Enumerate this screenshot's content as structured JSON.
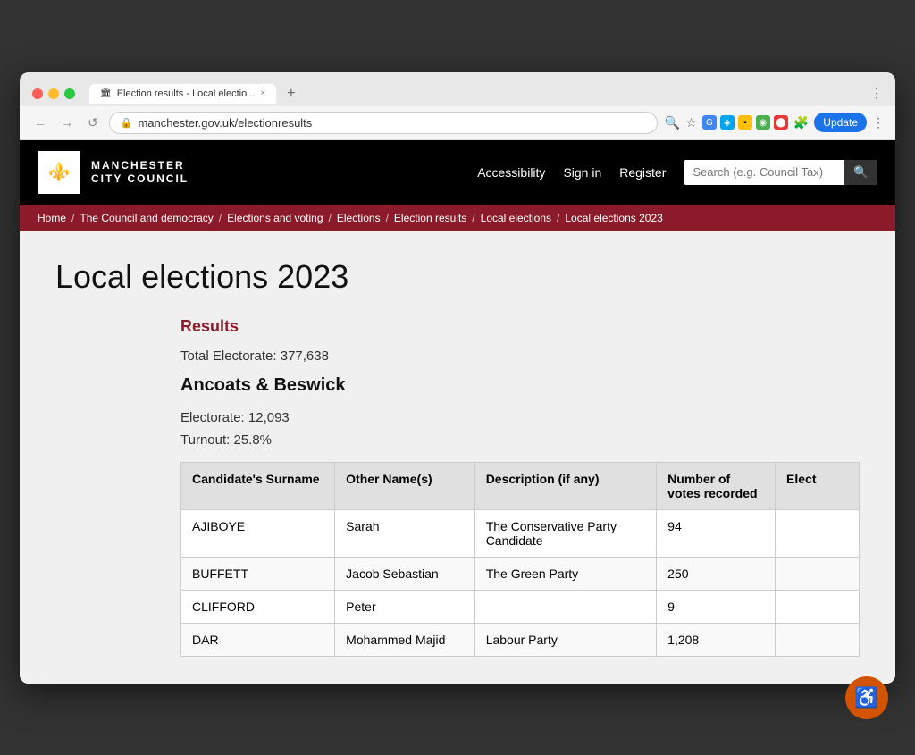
{
  "browser": {
    "tab_title": "Election results - Local electio...",
    "tab_close": "×",
    "url": "manchester.gov.uk/electionresults",
    "nav_back": "←",
    "nav_forward": "→",
    "nav_reload": "↺",
    "update_btn": "Update"
  },
  "site": {
    "logo_line1": "MANCHESTER",
    "logo_line2": "CITY COUNCIL",
    "nav_accessibility": "Accessibility",
    "nav_signin": "Sign in",
    "nav_register": "Register",
    "search_placeholder": "Search (e.g. Council Tax)"
  },
  "breadcrumb": {
    "items": [
      {
        "label": "Home",
        "sep": "/"
      },
      {
        "label": "The Council and democracy",
        "sep": "/"
      },
      {
        "label": "Elections and voting",
        "sep": "/"
      },
      {
        "label": "Elections",
        "sep": "/"
      },
      {
        "label": "Election results",
        "sep": "/"
      },
      {
        "label": "Local elections",
        "sep": "/"
      },
      {
        "label": "Local elections 2023",
        "sep": ""
      }
    ]
  },
  "page": {
    "title": "Local elections 2023",
    "results_heading": "Results",
    "total_electorate_label": "Total Electorate:",
    "total_electorate_value": "377,638",
    "ward_name": "Ancoats & Beswick",
    "electorate_label": "Electorate:",
    "electorate_value": "12,093",
    "turnout_label": "Turnout:",
    "turnout_value": "25.8%"
  },
  "table": {
    "columns": [
      "Candidate's Surname",
      "Other Name(s)",
      "Description (if any)",
      "Number of votes recorded",
      "Elect"
    ],
    "rows": [
      {
        "surname": "AJIBOYE",
        "other_names": "Sarah",
        "description": "The Conservative Party Candidate",
        "votes": "94",
        "elected": ""
      },
      {
        "surname": "BUFFETT",
        "other_names": "Jacob Sebastian",
        "description": "The Green Party",
        "votes": "250",
        "elected": ""
      },
      {
        "surname": "CLIFFORD",
        "other_names": "Peter",
        "description": "",
        "votes": "9",
        "elected": ""
      },
      {
        "surname": "DAR",
        "other_names": "Mohammed Majid",
        "description": "Labour Party",
        "votes": "1,208",
        "elected": ""
      }
    ]
  }
}
